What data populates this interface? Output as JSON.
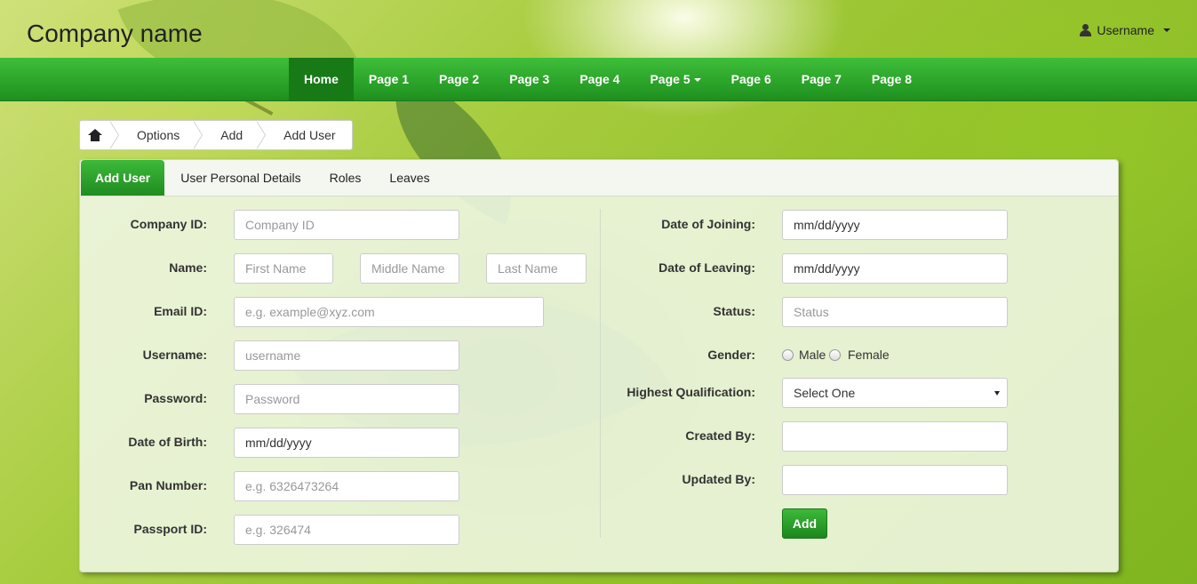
{
  "header": {
    "brand": "Company name",
    "user_label": "Username"
  },
  "nav": {
    "items": [
      {
        "label": "Home",
        "active": true
      },
      {
        "label": "Page 1"
      },
      {
        "label": "Page 2"
      },
      {
        "label": "Page 3"
      },
      {
        "label": "Page 4"
      },
      {
        "label": "Page 5",
        "dropdown": true
      },
      {
        "label": "Page 6"
      },
      {
        "label": "Page 7"
      },
      {
        "label": "Page 8"
      }
    ]
  },
  "breadcrumb": [
    "Options",
    "Add",
    "Add User"
  ],
  "tabs": [
    "Add User",
    "User Personal Details",
    "Roles",
    "Leaves"
  ],
  "form_left": {
    "company_id": {
      "label": "Company ID:",
      "placeholder": "Company ID"
    },
    "name": {
      "label": "Name:",
      "first": "First Name",
      "middle": "Middle Name",
      "last": "Last Name"
    },
    "email": {
      "label": "Email ID:",
      "placeholder": "e.g. example@xyz.com"
    },
    "username": {
      "label": "Username:",
      "placeholder": "username"
    },
    "password": {
      "label": "Password:",
      "placeholder": "Password"
    },
    "dob": {
      "label": "Date of Birth:",
      "value": "mm/dd/yyyy"
    },
    "pan": {
      "label": "Pan Number:",
      "placeholder": "e.g. 6326473264"
    },
    "passport": {
      "label": "Passport ID:",
      "placeholder": "e.g. 326474"
    }
  },
  "form_right": {
    "doj": {
      "label": "Date of Joining:",
      "value": "mm/dd/yyyy"
    },
    "dol": {
      "label": "Date of Leaving:",
      "value": "mm/dd/yyyy"
    },
    "status": {
      "label": "Status:",
      "placeholder": "Status"
    },
    "gender": {
      "label": "Gender:",
      "options": [
        "Male",
        "Female"
      ]
    },
    "qualification": {
      "label": "Highest Qualification:",
      "selected": "Select One"
    },
    "created_by": {
      "label": "Created By:",
      "value": ""
    },
    "updated_by": {
      "label": "Updated By:",
      "value": ""
    },
    "submit_label": "Add"
  },
  "colors": {
    "nav_green": "#2ca52a",
    "nav_active": "#177a17",
    "button_green": "#2a9f28"
  }
}
